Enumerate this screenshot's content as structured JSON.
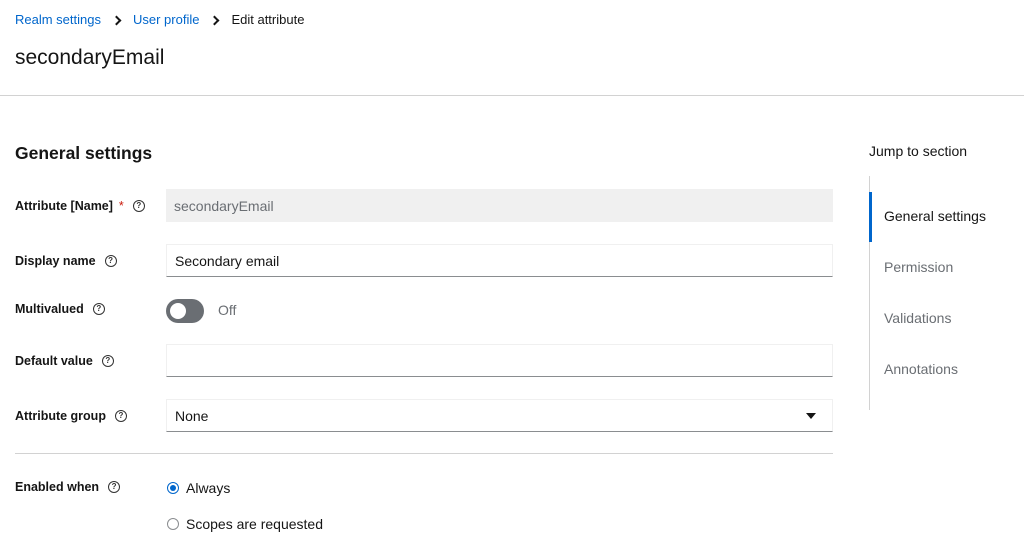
{
  "breadcrumb": {
    "items": [
      "Realm settings",
      "User profile"
    ],
    "current": "Edit attribute"
  },
  "page_title": "secondaryEmail",
  "section": {
    "title": "General settings"
  },
  "fields": {
    "attribute_name": {
      "label": "Attribute [Name]",
      "required_mark": "*",
      "value": "secondaryEmail"
    },
    "display_name": {
      "label": "Display name",
      "value": "Secondary email"
    },
    "multivalued": {
      "label": "Multivalued",
      "state_label": "Off",
      "checked": false
    },
    "default_value": {
      "label": "Default value",
      "value": ""
    },
    "attribute_group": {
      "label": "Attribute group",
      "selected": "None"
    },
    "enabled_when": {
      "label": "Enabled when",
      "options": [
        "Always",
        "Scopes are requested"
      ],
      "selected": "Always"
    }
  },
  "jump": {
    "title": "Jump to section",
    "items": [
      "General settings",
      "Permission",
      "Validations",
      "Annotations"
    ],
    "active": "General settings"
  },
  "colors": {
    "link": "#0066cc",
    "required": "#c9190b",
    "muted": "#6a6e73"
  },
  "icons": {
    "help": "question-circle-icon",
    "breadcrumb_separator": "chevron-right-icon",
    "select": "caret-down-icon"
  }
}
